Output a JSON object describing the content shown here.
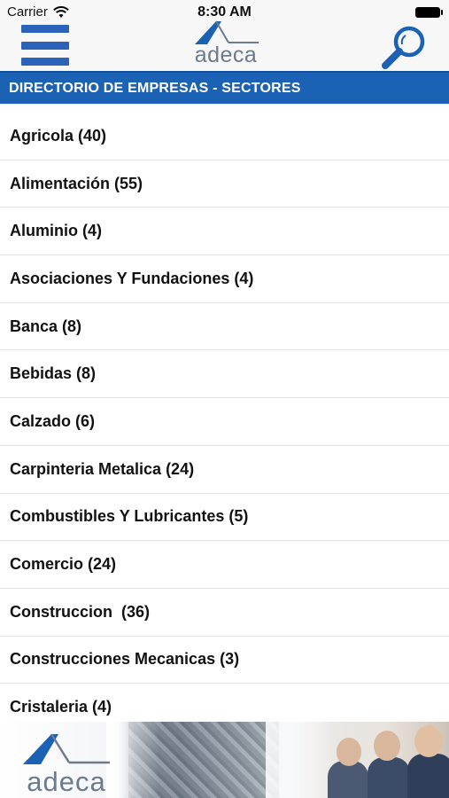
{
  "status_bar": {
    "carrier": "Carrier",
    "time": "8:30 AM"
  },
  "header": {
    "logo_text": "adeca",
    "brand_color": "#1c62b4",
    "menu_icon": "hamburger-menu-icon",
    "search_icon": "search-icon"
  },
  "section": {
    "title": "DIRECTORIO DE EMPRESAS - SECTORES"
  },
  "sectors": [
    {
      "label": "Agricola (40)"
    },
    {
      "label": "Alimentación (55)"
    },
    {
      "label": "Aluminio (4)"
    },
    {
      "label": "Asociaciones Y Fundaciones (4)"
    },
    {
      "label": "Banca (8)"
    },
    {
      "label": "Bebidas (8)"
    },
    {
      "label": "Calzado (6)"
    },
    {
      "label": "Carpinteria Metalica (24)"
    },
    {
      "label": "Combustibles Y Lubricantes (5)"
    },
    {
      "label": "Comercio (24)"
    },
    {
      "label": "Construccion  (36)"
    },
    {
      "label": "Construcciones Mecanicas (3)"
    },
    {
      "label": "Cristaleria (4)"
    }
  ],
  "footer": {
    "logo_text": "adeca"
  }
}
